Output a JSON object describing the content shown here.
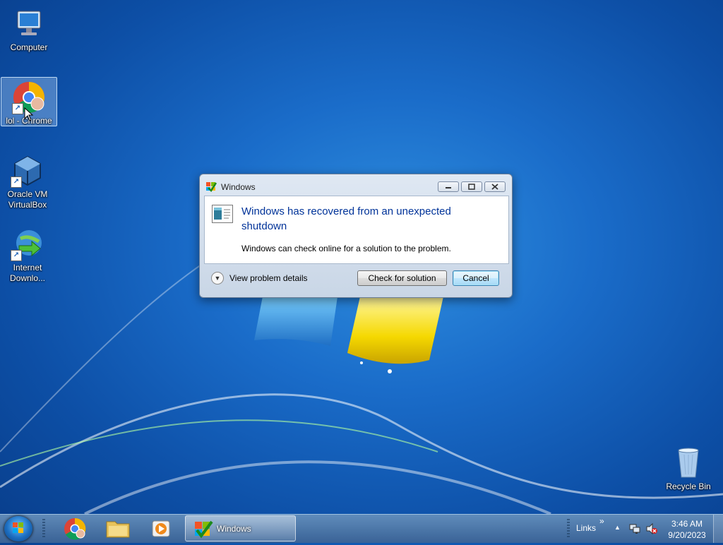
{
  "desktop": {
    "icons": [
      {
        "label": "Computer"
      },
      {
        "label": "lol - Chrome"
      },
      {
        "label": "Oracle VM VirtualBox"
      },
      {
        "label": "Internet Downlo..."
      },
      {
        "label": "Recycle Bin"
      }
    ]
  },
  "dialog": {
    "title": "Windows",
    "heading": "Windows has recovered from an unexpected shutdown",
    "message": "Windows can check online for a solution to the problem.",
    "details_label": "View problem details",
    "check_button": "Check for solution",
    "cancel_button": "Cancel"
  },
  "taskbar": {
    "pinned": [
      "chrome-icon",
      "file-explorer-icon",
      "media-player-icon"
    ],
    "active_window_label": "Windows",
    "links_label": "Links",
    "overflow_glyph": "»",
    "tray_arrow": "▲",
    "time": "3:46 AM",
    "date": "9/20/2023"
  },
  "colors": {
    "heading": "#003399",
    "desktop": "#1a6cc9"
  }
}
